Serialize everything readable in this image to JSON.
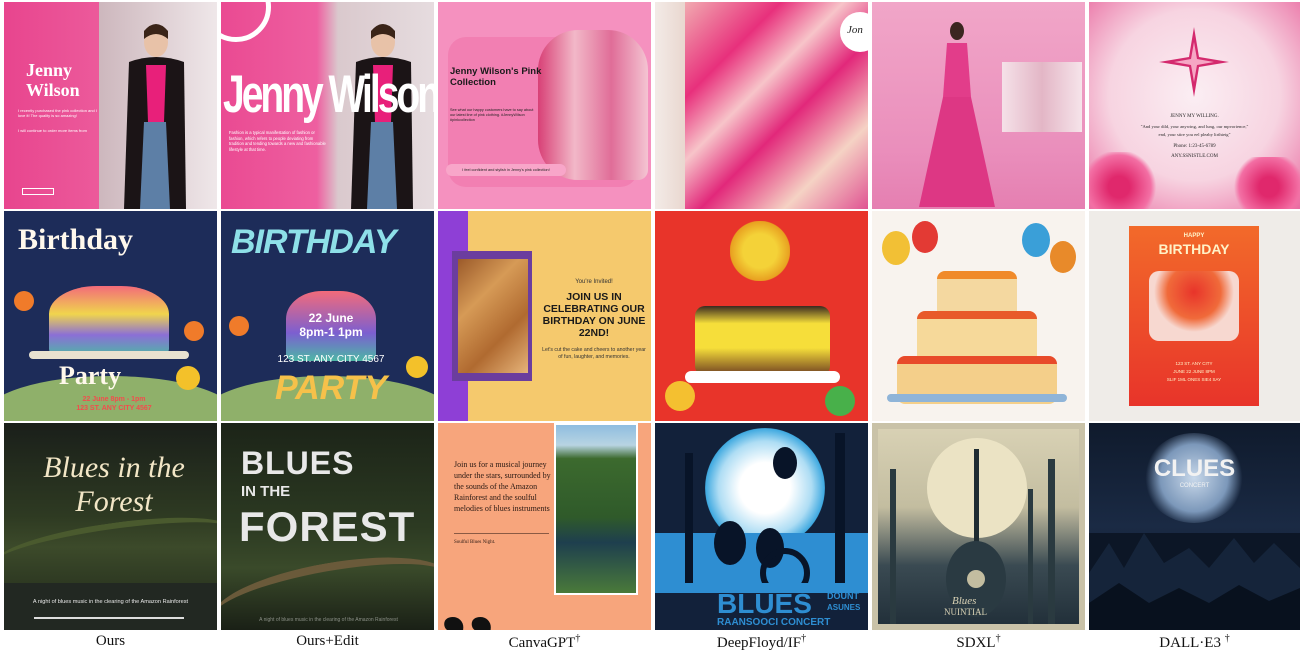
{
  "columns": [
    {
      "label": "Ours",
      "marker": ""
    },
    {
      "label": "Ours+Edit",
      "marker": ""
    },
    {
      "label": "CanvaGPT",
      "marker": "†"
    },
    {
      "label": "DeepFloyd/IF",
      "marker": "†"
    },
    {
      "label": "SDXL",
      "marker": "†"
    },
    {
      "label": "DALL·E3 ",
      "marker": "†"
    }
  ],
  "row1": {
    "ours": {
      "title_line1": "Jenny",
      "title_line2": "Wilson",
      "body1": "I recently purchased the pink collection and I love it! The quality is so amazing!",
      "body2": "I will continue to order more items from"
    },
    "edit": {
      "title": "Jenny Wilson",
      "body": "Fashion is a typical manifestation of fashion or fashion, which refers to people deviating from tradition and tending towards a new and fashionable lifestyle at that time."
    },
    "canva": {
      "title": "Jenny Wilson's Pink Collection",
      "body": "See what our happy customers have to say about our latest line of pink clothing. #JennyWilson #pinkcollection",
      "footer": "I feel confident and stylish in Jenny's pink collection!"
    },
    "deepfloyd": {
      "tag": "Jon"
    },
    "dalle": {
      "line1": "JENNY MY WILLING.",
      "line2": "\"And your dild, your anywing, and lung, our mpvorience,\"",
      "line3": "end, your stire you eel pleaby lirthteig\"",
      "line4": "Phone: 1:23-45-6789",
      "line5": "ANY.SSNISTLE.COM"
    }
  },
  "row2": {
    "ours": {
      "title": "Birthday",
      "party": "Party",
      "date": "22 June 8pm - 1pm",
      "address": "123 ST. ANY CITY 4567"
    },
    "edit": {
      "title": "BIRTHDAY",
      "date": "22 June",
      "time": "8pm-1 1pm",
      "address": "123 ST. ANY CITY 4567",
      "party": "PARTY"
    },
    "canva": {
      "invite": "You're Invited!",
      "headline": "JOIN US IN CELEBRATING OUR BIRTHDAY ON JUNE 22ND!",
      "body": "Let's cut the cake and cheers to another year of fun, laughter, and memories."
    },
    "dalle": {
      "happy": "HAPPY",
      "birthday": "BIRTHDAY",
      "small1": "123 ST. ANY CITY",
      "small2": "JUNE 22 JUNE 8PM",
      "small3": "SLIF 1ML ONES SIE4 SAY"
    }
  },
  "row3": {
    "ours": {
      "title_l1": "Blues in the",
      "title_l2": "Forest",
      "caption": "A night of blues music in the clearing of the Amazon Rainforest"
    },
    "edit": {
      "l1": "BLUES",
      "l2": "IN THE",
      "l3": "FOREST",
      "caption": "A night of blues music in the clearing of the Amazon Rainforest"
    },
    "canva": {
      "body": "Join us for a musical journey under the stars, surrounded by the sounds of the Amazon Rainforest and the soulful melodies of blues instruments",
      "footer": "Soulful Blues Night."
    },
    "deepfloyd": {
      "blues": "BLUES",
      "small1": "DOUNT",
      "small2": "ASUNES",
      "bottom": "RAANSOOCI CONCERT"
    },
    "sdxl": {
      "text1": "Blues",
      "text2": "NUINTIAL"
    },
    "dalle": {
      "title": "CLUES",
      "sub": "CONCERT"
    }
  }
}
